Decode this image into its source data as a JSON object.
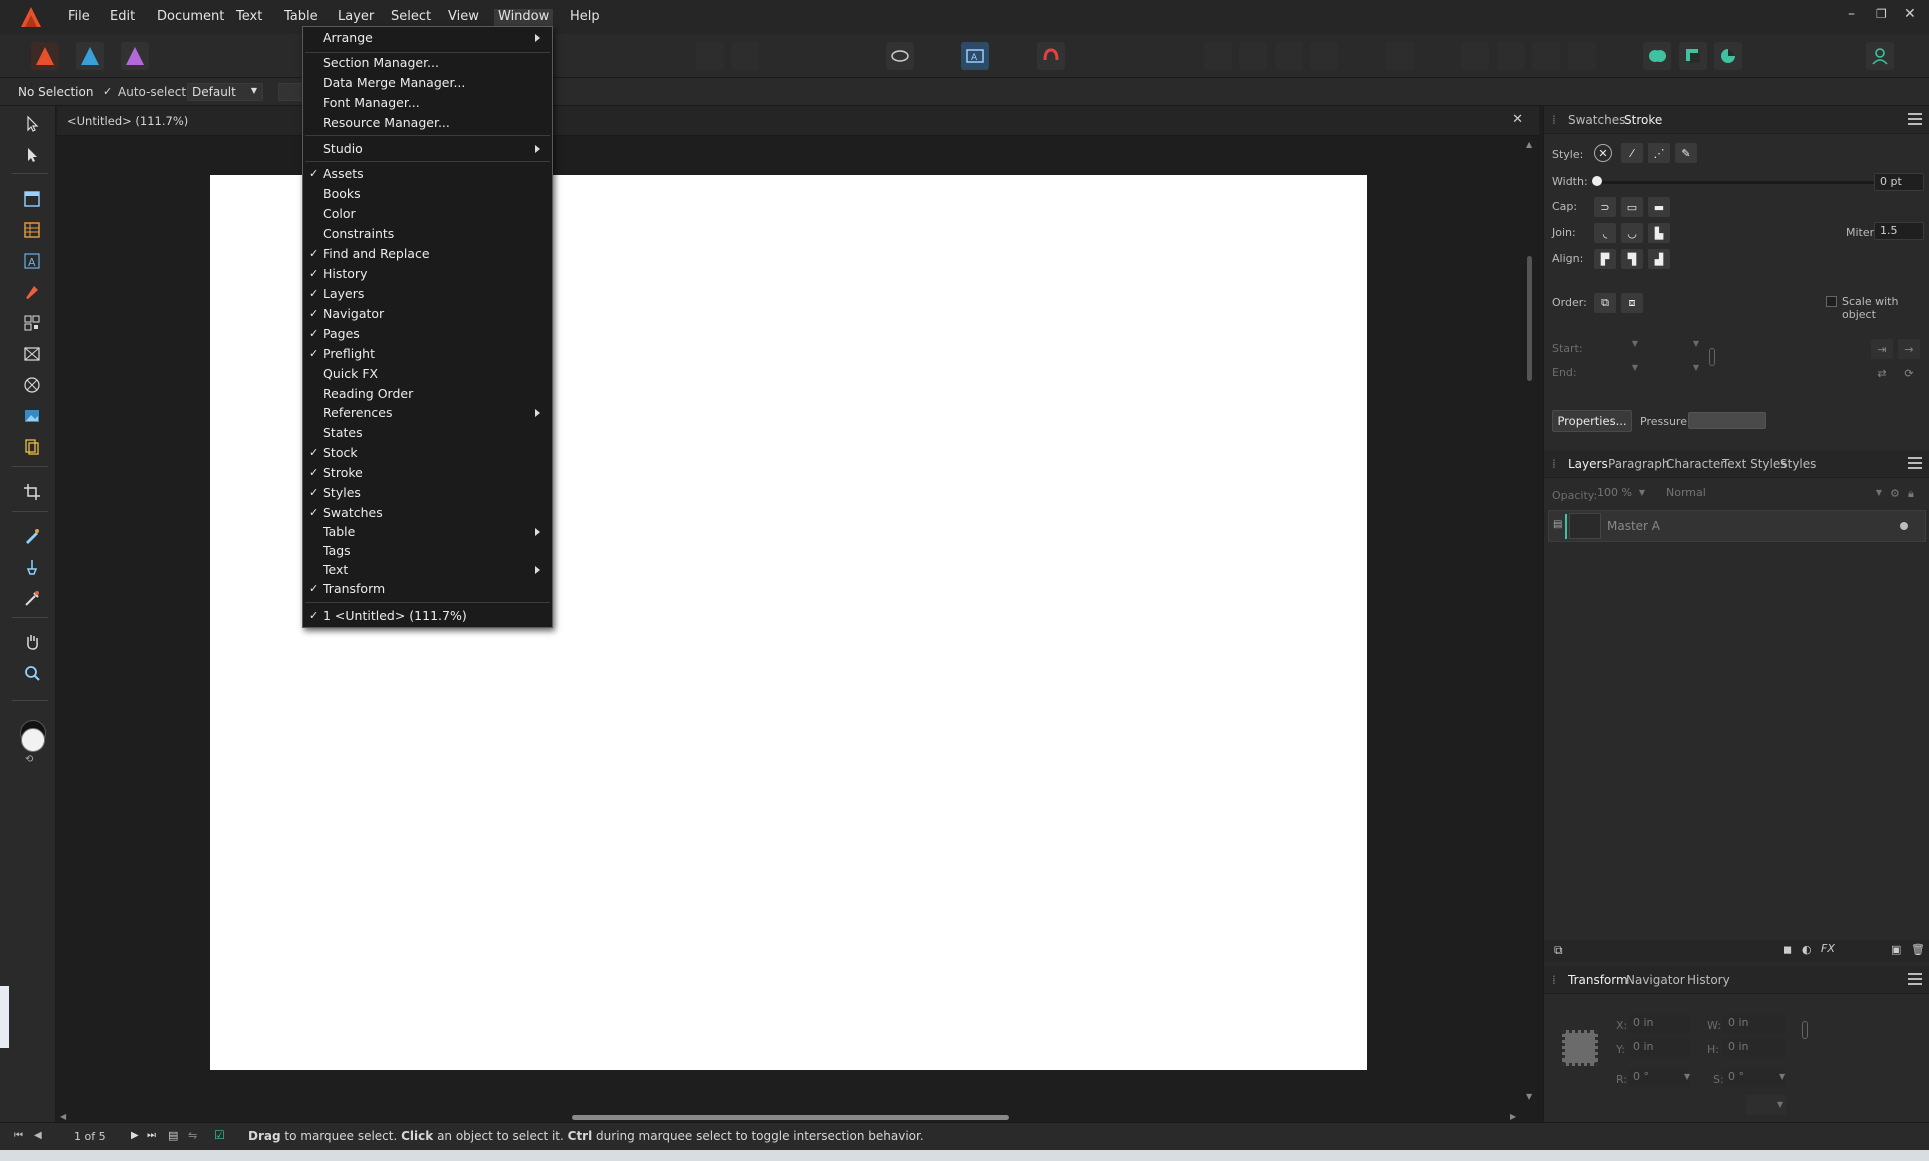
{
  "menubar": {
    "items": [
      "File",
      "Edit",
      "Document",
      "Text",
      "Table",
      "Layer",
      "Select",
      "View",
      "Window",
      "Help"
    ],
    "active": "Window",
    "accent": "#e8502c"
  },
  "window_menu": {
    "items": [
      {
        "label": "Arrange",
        "checked": false,
        "submenu": true
      },
      {
        "label": "Section Manager...",
        "checked": false,
        "submenu": false
      },
      {
        "label": "Data Merge Manager...",
        "checked": false,
        "submenu": false
      },
      {
        "label": "Font Manager...",
        "checked": false,
        "submenu": false
      },
      {
        "label": "Resource Manager...",
        "checked": false,
        "submenu": false
      },
      {
        "label": "Studio",
        "checked": false,
        "submenu": true
      },
      {
        "label": "Assets",
        "checked": true,
        "submenu": false
      },
      {
        "label": "Books",
        "checked": false,
        "submenu": false
      },
      {
        "label": "Color",
        "checked": false,
        "submenu": false
      },
      {
        "label": "Constraints",
        "checked": false,
        "submenu": false
      },
      {
        "label": "Find and Replace",
        "checked": true,
        "submenu": false
      },
      {
        "label": "History",
        "checked": true,
        "submenu": false
      },
      {
        "label": "Layers",
        "checked": true,
        "submenu": false
      },
      {
        "label": "Navigator",
        "checked": true,
        "submenu": false
      },
      {
        "label": "Pages",
        "checked": true,
        "submenu": false
      },
      {
        "label": "Preflight",
        "checked": true,
        "submenu": false
      },
      {
        "label": "Quick FX",
        "checked": false,
        "submenu": false
      },
      {
        "label": "Reading Order",
        "checked": false,
        "submenu": false
      },
      {
        "label": "References",
        "checked": false,
        "submenu": true
      },
      {
        "label": "States",
        "checked": false,
        "submenu": false
      },
      {
        "label": "Stock",
        "checked": true,
        "submenu": false
      },
      {
        "label": "Stroke",
        "checked": true,
        "submenu": false
      },
      {
        "label": "Styles",
        "checked": true,
        "submenu": false
      },
      {
        "label": "Swatches",
        "checked": true,
        "submenu": false
      },
      {
        "label": "Table",
        "checked": false,
        "submenu": true
      },
      {
        "label": "Tags",
        "checked": false,
        "submenu": false
      },
      {
        "label": "Text",
        "checked": false,
        "submenu": true
      },
      {
        "label": "Transform",
        "checked": true,
        "submenu": false
      },
      {
        "label": "1 <Untitled> (111.7%)",
        "checked": true,
        "submenu": false
      }
    ],
    "check_glyph": "✓"
  },
  "context_bar": {
    "selection": "No Selection",
    "auto_select_label": "Auto-select:",
    "auto_select_value": "Default"
  },
  "document": {
    "tab_title": "<Untitled> (111.7%)"
  },
  "stroke_panel": {
    "tabs": [
      "Swatches",
      "Stroke"
    ],
    "active_tab": "Stroke",
    "style_label": "Style:",
    "width_label": "Width:",
    "width_value": "0 pt",
    "cap_label": "Cap:",
    "join_label": "Join:",
    "miter_label": "Miter:",
    "miter_value": "1.5",
    "align_label": "Align:",
    "order_label": "Order:",
    "scale_with_object_label": "Scale with object",
    "start_label": "Start:",
    "end_label": "End:",
    "properties_button": "Properties...",
    "pressure_label": "Pressure:"
  },
  "layers_panel": {
    "tabs": [
      "Layers",
      "Paragraph",
      "Character",
      "Text Styles",
      "Styles"
    ],
    "active_tab": "Layers",
    "opacity_label": "Opacity:",
    "opacity_value": "100 %",
    "blend_mode": "Normal",
    "layer_name": "Master A"
  },
  "transform_panel": {
    "tabs": [
      "Transform",
      "Navigator",
      "History"
    ],
    "active_tab": "Transform",
    "x_label": "X:",
    "x_value": "0 in",
    "y_label": "Y:",
    "y_value": "0 in",
    "w_label": "W:",
    "w_value": "0 in",
    "h_label": "H:",
    "h_value": "0 in",
    "r_label": "R:",
    "r_value": "0 °",
    "s_label": "S:",
    "s_value": "0 °"
  },
  "status_bar": {
    "page_indicator": "1 of 5",
    "hint_parts": [
      {
        "text": "Drag",
        "bold": true
      },
      {
        "text": " to marquee select. ",
        "bold": false
      },
      {
        "text": "Click",
        "bold": true
      },
      {
        "text": " an object to select it. ",
        "bold": false
      },
      {
        "text": "Ctrl",
        "bold": true
      },
      {
        "text": " during marquee select to toggle intersection behavior.",
        "bold": false
      }
    ]
  },
  "icons": {
    "app_logo": "affinity-publisher-icon",
    "close": "✕",
    "minimize": "–",
    "restore": "❐"
  }
}
